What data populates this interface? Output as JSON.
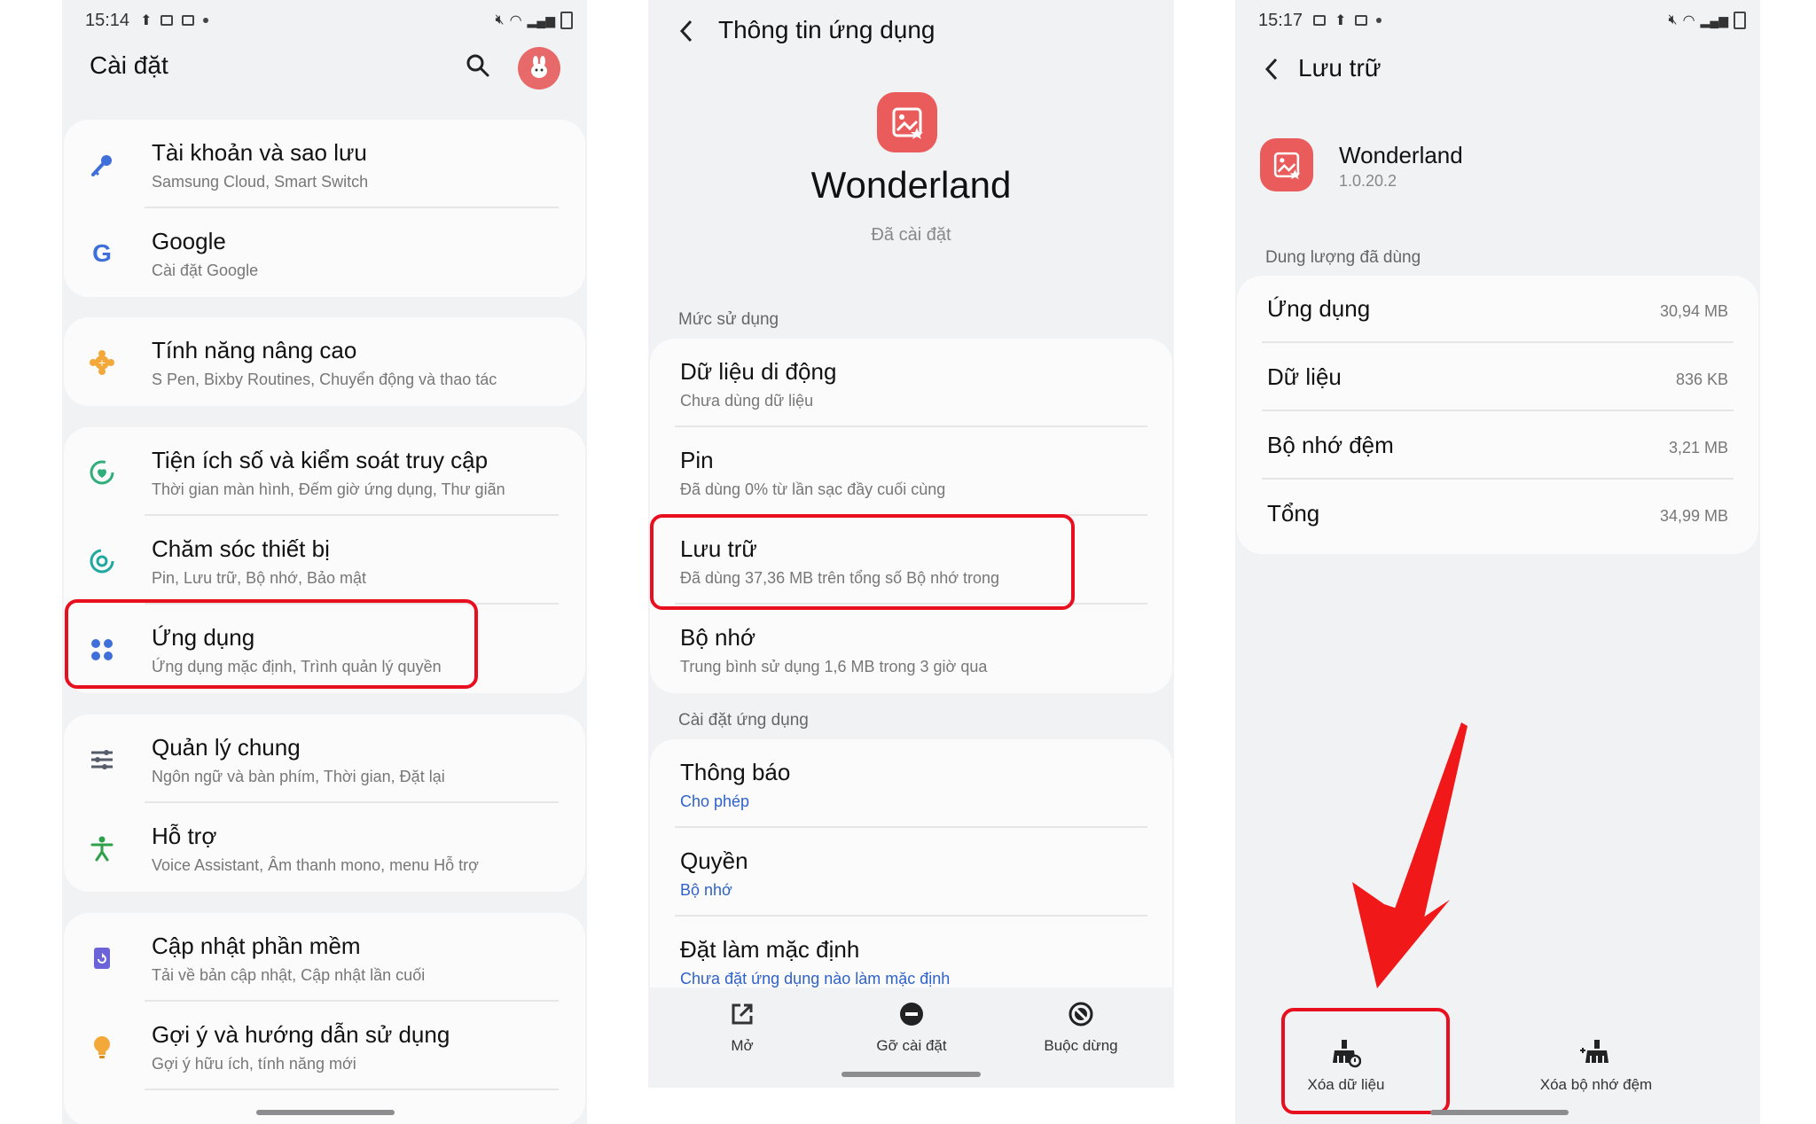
{
  "panel1": {
    "status": {
      "time": "15:14"
    },
    "title": "Cài đặt",
    "items": [
      {
        "title": "Tài khoản và sao lưu",
        "sub": "Samsung Cloud, Smart Switch"
      },
      {
        "title": "Google",
        "sub": "Cài đặt Google"
      },
      {
        "title": "Tính năng nâng cao",
        "sub": "S Pen, Bixby Routines, Chuyển động và thao tác"
      },
      {
        "title": "Tiện ích số và kiểm soát truy cập",
        "sub": "Thời gian màn hình, Đếm giờ ứng dụng, Thư giãn"
      },
      {
        "title": "Chăm sóc thiết bị",
        "sub": "Pin, Lưu trữ, Bộ nhớ, Bảo mật"
      },
      {
        "title": "Ứng dụng",
        "sub": "Ứng dụng mặc định, Trình quản lý quyền"
      },
      {
        "title": "Quản lý chung",
        "sub": "Ngôn ngữ và bàn phím, Thời gian, Đặt lại"
      },
      {
        "title": "Hỗ trợ",
        "sub": "Voice Assistant, Âm thanh mono, menu Hỗ trợ"
      },
      {
        "title": "Cập nhật phần mềm",
        "sub": "Tải về bản cập nhật, Cập nhật lần cuối"
      },
      {
        "title": "Gợi ý và hướng dẫn sử dụng",
        "sub": "Gợi ý hữu ích, tính năng mới"
      }
    ],
    "colors": {
      "accent_blue": "#3f6fd8",
      "highlight_red": "#e8101f"
    }
  },
  "panel2": {
    "title": "Thông tin ứng dụng",
    "app_name": "Wonderland",
    "app_status": "Đã cài đặt",
    "section_usage": "Mức sử dụng",
    "usage_items": [
      {
        "title": "Dữ liệu di động",
        "sub": "Chưa dùng dữ liệu"
      },
      {
        "title": "Pin",
        "sub": "Đã dùng 0% từ lần sạc đầy cuối cùng"
      },
      {
        "title": "Lưu trữ",
        "sub": "Đã dùng 37,36 MB trên tổng số Bộ nhớ trong"
      },
      {
        "title": "Bộ nhớ",
        "sub": "Trung bình sử dụng 1,6 MB trong 3 giờ qua"
      }
    ],
    "section_settings": "Cài đặt ứng dụng",
    "settings_items": [
      {
        "title": "Thông báo",
        "sub": "Cho phép"
      },
      {
        "title": "Quyền",
        "sub": "Bộ nhớ"
      },
      {
        "title": "Đặt làm mặc định",
        "sub": "Chưa đặt ứng dụng nào làm mặc định"
      }
    ],
    "actions": {
      "open": "Mở",
      "uninstall": "Gỡ cài đặt",
      "force_stop": "Buộc dừng"
    }
  },
  "panel3": {
    "status": {
      "time": "15:17"
    },
    "title": "Lưu trữ",
    "app_name": "Wonderland",
    "app_version": "1.0.20.2",
    "section_used": "Dung lượng đã dùng",
    "rows": [
      {
        "label": "Ứng dụng",
        "value": "30,94 MB"
      },
      {
        "label": "Dữ liệu",
        "value": "836 KB"
      },
      {
        "label": "Bộ nhớ đệm",
        "value": "3,21 MB"
      },
      {
        "label": "Tổng",
        "value": "34,99 MB"
      }
    ],
    "actions": {
      "clear_data": "Xóa dữ liệu",
      "clear_cache": "Xóa bộ nhớ đệm"
    }
  }
}
